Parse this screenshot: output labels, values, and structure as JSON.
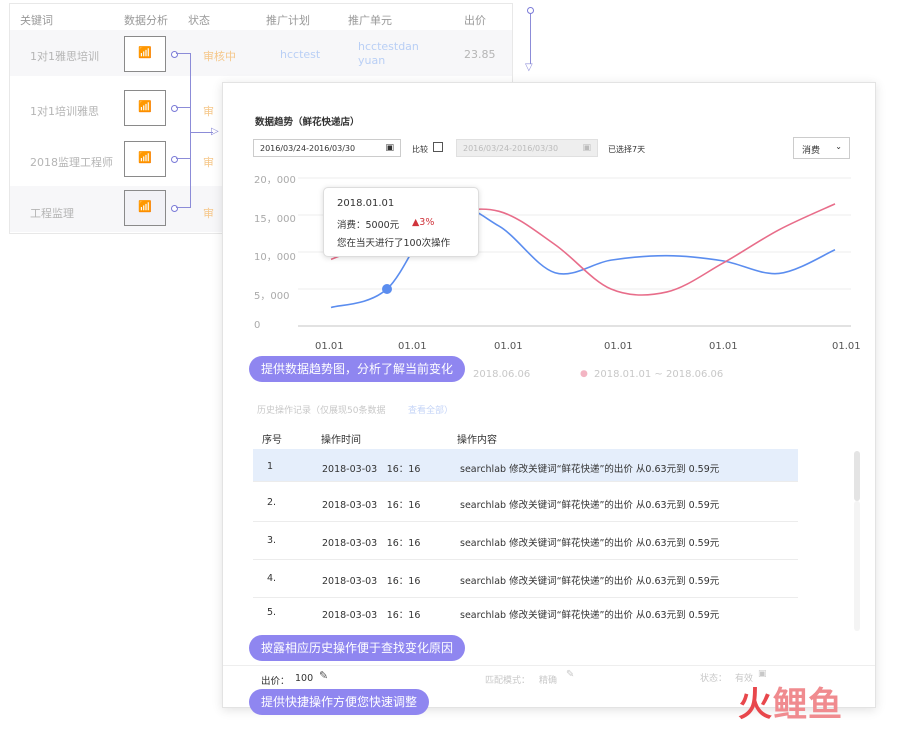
{
  "keyword_table": {
    "headers": [
      "关键词",
      "数据分析",
      "状态",
      "推广计划",
      "推广单元",
      "出价"
    ],
    "rows": [
      {
        "keyword": "1对1雅思培训",
        "status": "审核中",
        "plan": "hcctest",
        "unit": "hcctestdanyuan",
        "price": "23.85"
      },
      {
        "keyword": "1对1培训雅思",
        "status": "审",
        "plan": "",
        "unit": "",
        "price": ""
      },
      {
        "keyword": "2018监理工程师",
        "status": "审",
        "plan": "",
        "unit": "",
        "price": ""
      },
      {
        "keyword": "工程监理",
        "status": "审",
        "plan": "",
        "unit": "",
        "price": ""
      }
    ],
    "chart_icon": "bar-chart-icon"
  },
  "panel": {
    "title": "数据趋势（鲜花快递店）",
    "date_range": "2016/03/24-2016/03/30",
    "compare_label": "比较",
    "compare_range": "2016/03/24-2016/03/30",
    "selected_days": "已选择7天",
    "metric_select": "消费",
    "legend_faint": [
      "2018.06.06",
      "2018.01.01 ~ 2018.06.06"
    ]
  },
  "tooltip": {
    "date": "2018.01.01",
    "cost_label": "消费：5000元",
    "change": "▲3%",
    "ops": "您在当天进行了100次操作"
  },
  "chart_data": {
    "type": "line",
    "y_ticks": [
      "20，000",
      "15，000",
      "10，000",
      "5，000",
      "0"
    ],
    "x_ticks": [
      "01.01",
      "01.01",
      "01.01",
      "01.01",
      "01.01",
      "01.01"
    ],
    "ylim": [
      0,
      20000
    ],
    "series": [
      {
        "color": "#5b8def",
        "values": [
          2500,
          5000,
          16000,
          13500,
          7200,
          8900,
          9500,
          8800,
          7100,
          10300
        ]
      },
      {
        "color": "#e86d8a",
        "values": [
          9000,
          12000,
          15000,
          15500,
          11000,
          5000,
          4600,
          8500,
          13000,
          16500
        ]
      }
    ]
  },
  "tags": {
    "trend": "提供数据趋势图，分析了解当前变化",
    "history": "披露相应历史操作便于查找变化原因",
    "quick": "提供快捷操作方便您快速调整"
  },
  "history": {
    "caption": "历史操作记录（仅展现50条数据",
    "view_all": "查看全部）",
    "headers": [
      "序号",
      "操作时间",
      "操作内容"
    ],
    "rows": [
      {
        "no": "1",
        "time": "2018-03-03　16：16",
        "content": "searchlab 修改关键词“鲜花快递”的出价 从0.63元到 0.59元"
      },
      {
        "no": "2.",
        "time": "2018-03-03　16：16",
        "content": "searchlab 修改关键词“鲜花快递”的出价 从0.63元到 0.59元"
      },
      {
        "no": "3.",
        "time": "2018-03-03　16：16",
        "content": "searchlab 修改关键词“鲜花快递”的出价 从0.63元到 0.59元"
      },
      {
        "no": "4.",
        "time": "2018-03-03　16：16",
        "content": "searchlab 修改关键词“鲜花快递”的出价 从0.63元到 0.59元"
      },
      {
        "no": "5.",
        "time": "2018-03-03　16：16",
        "content": "searchlab 修改关键词“鲜花快递”的出价 从0.63元到 0.59元"
      }
    ]
  },
  "footer": {
    "bid_label": "出价：",
    "bid_value": "100",
    "match_label": "匹配模式：",
    "match_value": "精确",
    "status_label": "状态：",
    "status_value": "有效"
  },
  "watermark": "火鲤鱼"
}
